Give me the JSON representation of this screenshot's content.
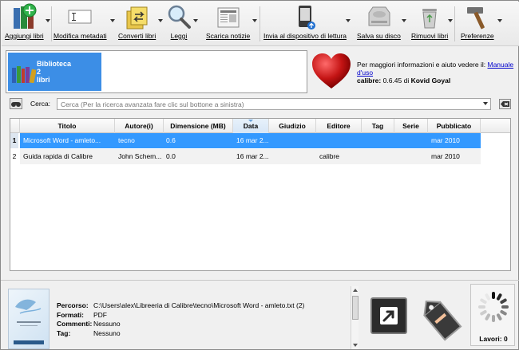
{
  "toolbar": {
    "buttons": [
      {
        "label": "Aggiungi libri",
        "icon": "add-books-icon"
      },
      {
        "label": "Modifica metadati",
        "icon": "edit-metadata-icon"
      },
      {
        "label": "Converti libri",
        "icon": "convert-books-icon"
      },
      {
        "label": "Leggi",
        "icon": "magnifier-icon"
      },
      {
        "label": "Scarica notizie",
        "icon": "newspaper-icon"
      },
      {
        "label": "Invia al dispositivo di lettura",
        "icon": "reader-device-icon"
      },
      {
        "label": "Salva su disco",
        "icon": "hard-disk-icon"
      },
      {
        "label": "Rimuovi libri",
        "icon": "trash-icon"
      },
      {
        "label": "Preferenze",
        "icon": "hammer-icon"
      }
    ]
  },
  "library": {
    "name": "Biblioteca",
    "count": "2",
    "count_label": "libri"
  },
  "info": {
    "help_text": "Per maggiori informazioni e aiuto vedere il:",
    "manual_link": "Manuale d'uso",
    "app_name": "calibre:",
    "version_by": " 0.6.45 di ",
    "author": "Kovid Goyal"
  },
  "search": {
    "label": "Cerca:",
    "placeholder": "Cerca (Per la ricerca avanzata fare clic sul bottone a sinistra)"
  },
  "table": {
    "columns": [
      "Titolo",
      "Autore(i)",
      "Dimensione (MB)",
      "Data",
      "Giudizio",
      "Editore",
      "Tag",
      "Serie",
      "Pubblicato"
    ],
    "sorted_column": "Data",
    "rows": [
      {
        "num": "1",
        "title": "Microsoft Word - amleto...",
        "author": "tecno",
        "size": "0.6",
        "date": "16 mar 2...",
        "rating": "",
        "publisher": "",
        "tags": "",
        "series": "",
        "published": "mar 2010",
        "selected": true
      },
      {
        "num": "2",
        "title": "Guida rapida di Calibre",
        "author": "John Schem...",
        "size": "0.0",
        "date": "16 mar 2...",
        "rating": "",
        "publisher": "calibre",
        "tags": "",
        "series": "",
        "published": "mar 2010",
        "selected": false
      }
    ]
  },
  "details": {
    "path_key": "Percorso:",
    "path_val": "C:\\Users\\alex\\Libreeria di Calibre\\tecno\\Microsoft Word - amleto.txt (2)",
    "formats_key": "Formati:",
    "formats_val": "PDF",
    "comments_key": "Commenti:",
    "comments_val": "Nessuno",
    "tags_key": "Tag:",
    "tags_val": "Nessuno"
  },
  "jobs": {
    "label": "Lavori: 0"
  },
  "colors": {
    "selection": "#3399ff",
    "library_tile": "#3c8ee6",
    "link": "#0000cc"
  }
}
